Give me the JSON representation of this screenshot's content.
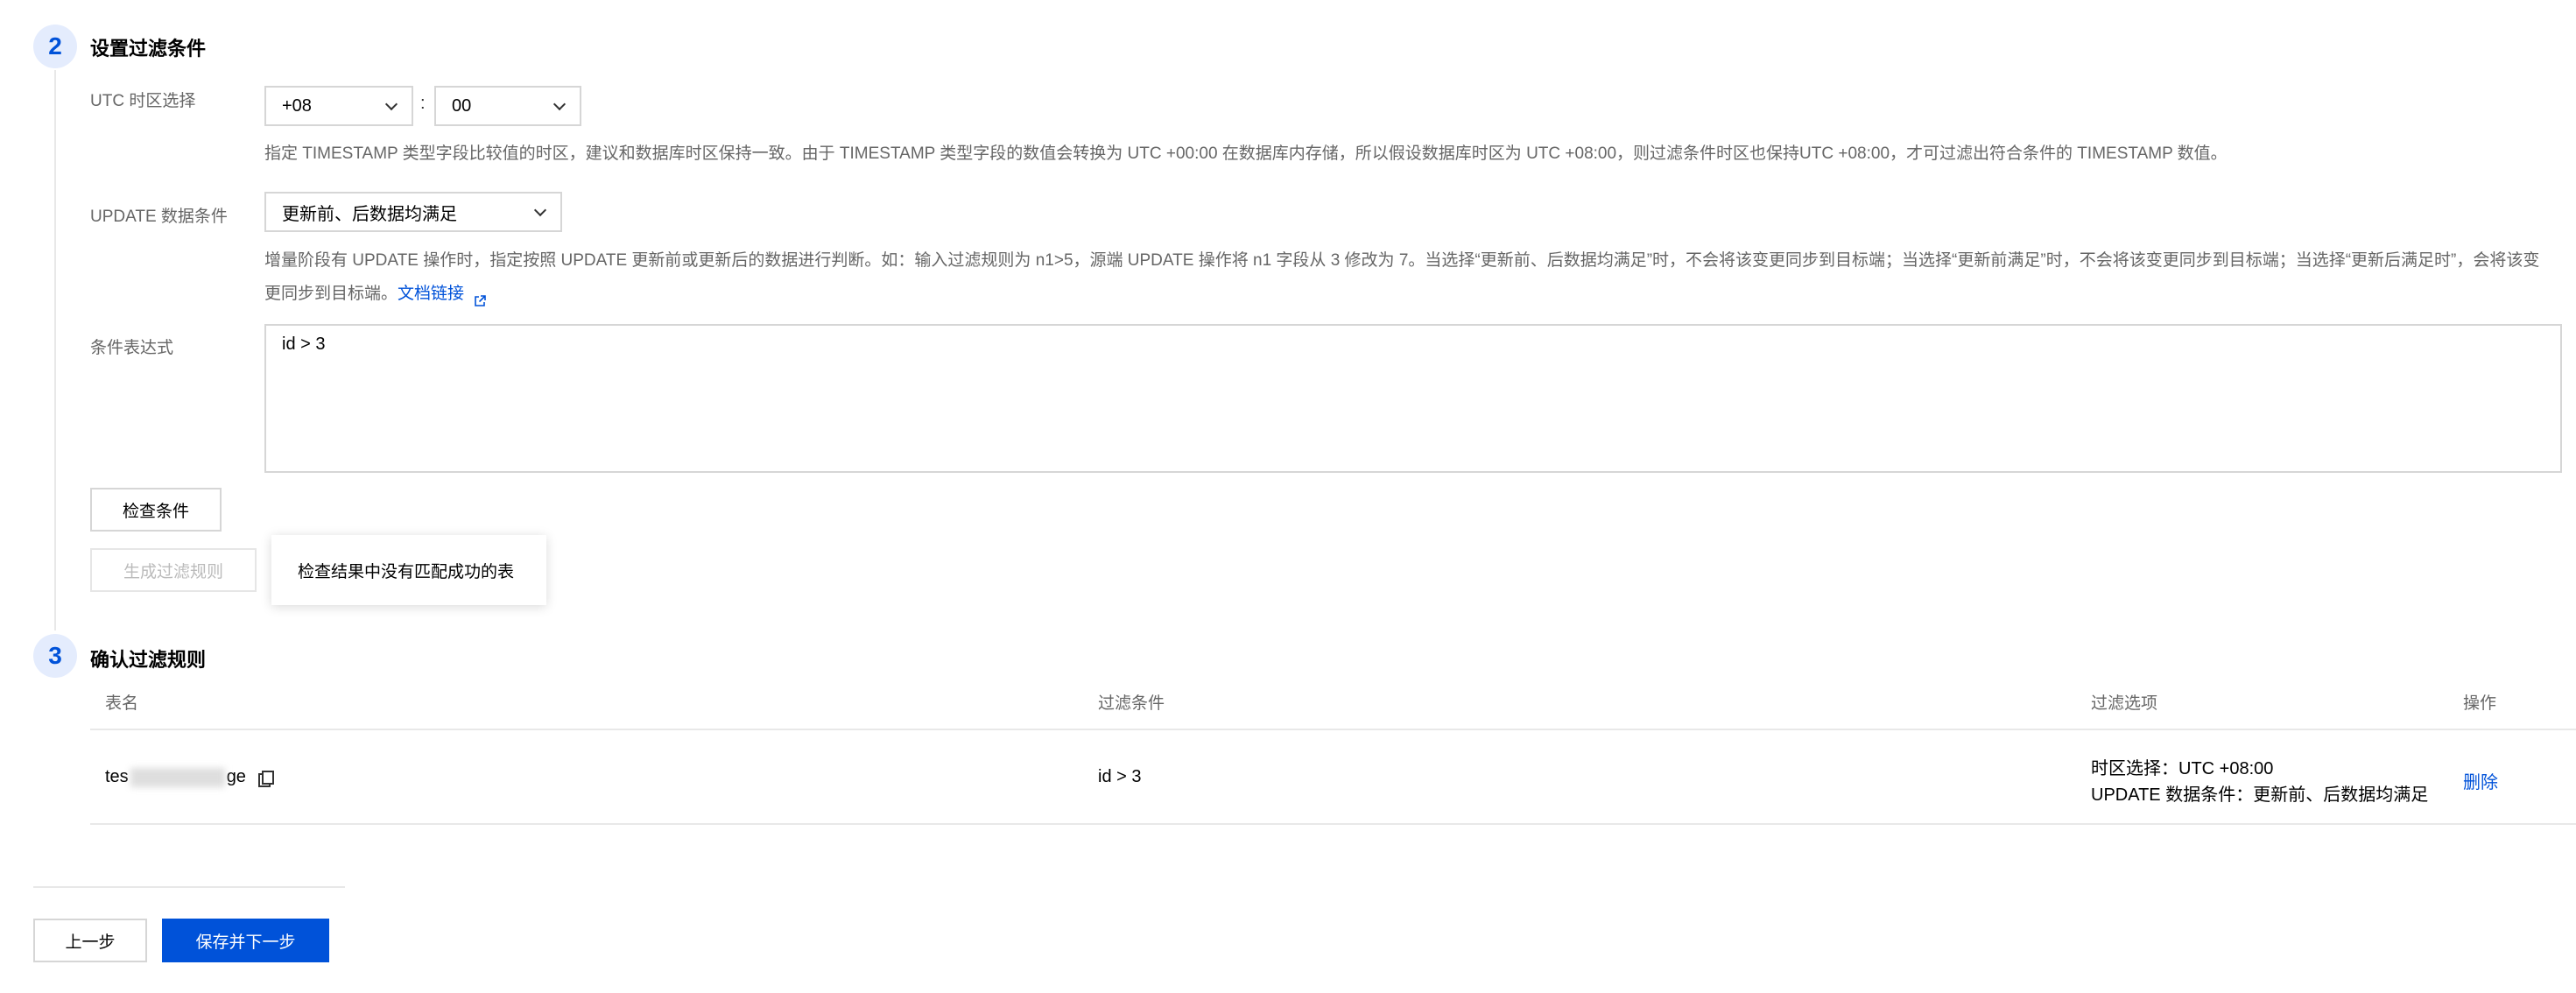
{
  "step2": {
    "number": "2",
    "title": "设置过滤条件",
    "utc": {
      "label": "UTC 时区选择",
      "hour_value": "+08",
      "separator": ":",
      "minute_value": "00",
      "hint": "指定 TIMESTAMP 类型字段比较值的时区，建议和数据库时区保持一致。由于 TIMESTAMP 类型字段的数值会转换为 UTC +00:00 在数据库内存储，所以假设数据库时区为 UTC +08:00，则过滤条件时区也保持UTC +08:00，才可过滤出符合条件的 TIMESTAMP 数值。"
    },
    "update": {
      "label": "UPDATE 数据条件",
      "value": "更新前、后数据均满足",
      "hint": "增量阶段有 UPDATE 操作时，指定按照 UPDATE 更新前或更新后的数据进行判断。如：输入过滤规则为 n1>5，源端 UPDATE 操作将 n1 字段从 3 修改为 7。当选择“更新前、后数据均满足”时，不会将该变更同步到目标端；当选择“更新前满足”时，不会将该变更同步到目标端；当选择“更新后满足时”，会将该变更同步到目标端。",
      "doc_link": "文档链接"
    },
    "expression": {
      "label": "条件表达式",
      "value": "id > 3"
    },
    "check_button": "检查条件",
    "generate_button": "生成过滤规则",
    "tooltip": "检查结果中没有匹配成功的表"
  },
  "step3": {
    "number": "3",
    "title": "确认过滤规则",
    "columns": [
      "表名",
      "过滤条件",
      "过滤选项",
      "操作"
    ],
    "row": {
      "table_prefix": "tes",
      "table_suffix": "ge",
      "condition": "id > 3",
      "option_line1": "时区选择：UTC +08:00",
      "option_line2": "UPDATE 数据条件：更新前、后数据均满足",
      "action": "删除"
    }
  },
  "footer": {
    "prev_button": "上一步",
    "next_button": "保存并下一步"
  },
  "colors": {
    "primary": "#0052d9",
    "step_circle_bg": "#e4ecfd"
  }
}
